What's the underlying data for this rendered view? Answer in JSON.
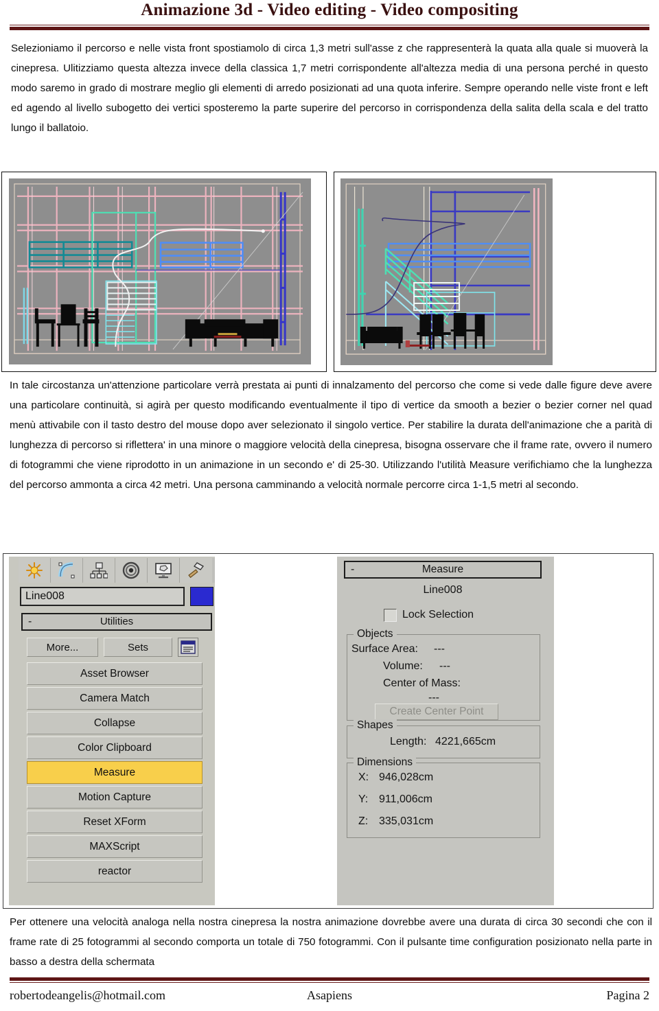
{
  "header": {
    "title": "Animazione 3d - Video editing - Video compositing"
  },
  "body": {
    "paragraph1": "Selezioniamo il percorso e nelle vista front spostiamolo di circa 1,3 metri sull'asse z che rappresenterà la quata alla quale si muoverà la cinepresa. Ulitizziamo questa altezza invece della classica 1,7 metri corrispondente all'altezza media di una persona perché in questo modo saremo in grado di mostrare meglio gli elementi di arredo posizionati ad una quota inferire. Sempre operando nelle viste front e left ed agendo al livello subogetto dei vertici sposteremo la parte superire del percorso in corrispondenza della salita della scala e del tratto lungo il ballatoio.",
    "paragraph2": "In tale circostanza un'attenzione particolare verrà prestata ai punti di innalzamento del percorso  che come si vede dalle figure deve avere una particolare continuità, si agirà per questo modificando eventualmente il tipo di vertice da smooth a bezier o bezier corner nel quad menù attivabile con il tasto destro del mouse dopo aver selezionato il singolo vertice. Per stabilire la durata dell'animazione che a parità di lunghezza di percorso si riflettera' in una minore o maggiore velocità della cinepresa, bisogna osservare che il frame rate, ovvero il numero di fotogrammi che viene riprodotto in un animazione in un secondo e' di 25-30. Utilizzando l'utilità Measure verifichiamo che la lunghezza del percorso ammonta a circa 42 metri. Una persona camminando a velocità normale percorre circa 1-1,5 metri al secondo.",
    "paragraph3": "Per ottenere una velocità analoga nella nostra cinepresa la nostra animazione dovrebbe avere una durata di circa 30 secondi che con il frame rate di 25 fotogrammi al secondo comporta un totale di 750 fotogrammi. Con il pulsante time configuration posizionato nella parte in basso a destra della schermata"
  },
  "figure_viewports": {
    "left_viewport": {
      "name": "front-viewport",
      "background_color": "#8e8e8e",
      "grid_color": "#f0b8c0",
      "wire_colors": [
        "#26b0b0",
        "#4d8ef5",
        "#38e8c0",
        "#e8e8e8",
        "#3a3ad0",
        "#7fe0e8"
      ]
    },
    "right_viewport": {
      "name": "left-viewport",
      "background_color": "#8e8e8e",
      "grid_color": "#f0b8c0",
      "wire_colors": [
        "#3a3ad0",
        "#4d8ef5",
        "#38e8c0",
        "#e8e8e8",
        "#7fe0e8"
      ]
    }
  },
  "max_ui": {
    "command_tabs": [
      {
        "name": "create-tab",
        "icon": "star-icon"
      },
      {
        "name": "modify-tab",
        "icon": "curve-icon"
      },
      {
        "name": "hierarchy-tab",
        "icon": "hierarchy-icon"
      },
      {
        "name": "motion-tab",
        "icon": "wheel-icon"
      },
      {
        "name": "display-tab",
        "icon": "monitor-icon"
      },
      {
        "name": "utilities-tab",
        "icon": "hammer-icon"
      }
    ],
    "object_name": "Line008",
    "object_color": "#2a2ad0",
    "utilities_rollout": {
      "title": "Utilities",
      "collapse_glyph": "-",
      "more_label": "More...",
      "sets_label": "Sets",
      "config_icon": "configure-sets-icon",
      "buttons": [
        "Asset Browser",
        "Camera Match",
        "Collapse",
        "Color Clipboard",
        "Measure",
        "Motion Capture",
        "Reset XForm",
        "MAXScript",
        "reactor"
      ],
      "active_button": "Measure",
      "active_color": "#f8cf4b"
    },
    "measure_rollout": {
      "title": "Measure",
      "collapse_glyph": "-",
      "object_name": "Line008",
      "lock_selection_label": "Lock Selection",
      "lock_selection_checked": false,
      "objects_group": {
        "title": "Objects",
        "surface_area_label": "Surface Area:",
        "surface_area_value": "---",
        "volume_label": "Volume:",
        "volume_value": "---",
        "center_of_mass_label": "Center of Mass:",
        "center_of_mass_value": "---",
        "create_center_point_label": "Create Center Point",
        "create_center_point_enabled": false
      },
      "shapes_group": {
        "title": "Shapes",
        "length_label": "Length:",
        "length_value": "4221,665cm"
      },
      "dimensions_group": {
        "title": "Dimensions",
        "x_label": "X:",
        "x_value": "946,028cm",
        "y_label": "Y:",
        "y_value": "911,006cm",
        "z_label": "Z:",
        "z_value": "335,031cm"
      }
    }
  },
  "footer": {
    "email": "robertodeangelis@hotmail.com",
    "center": "Asapiens",
    "page": "Pagina 2"
  },
  "colors": {
    "rule": "#5e1616",
    "title": "#3a1111",
    "panel_bg": "#c5c5c0",
    "highlight": "#f8cf4b",
    "yellow_strip": "#e9e21f"
  }
}
